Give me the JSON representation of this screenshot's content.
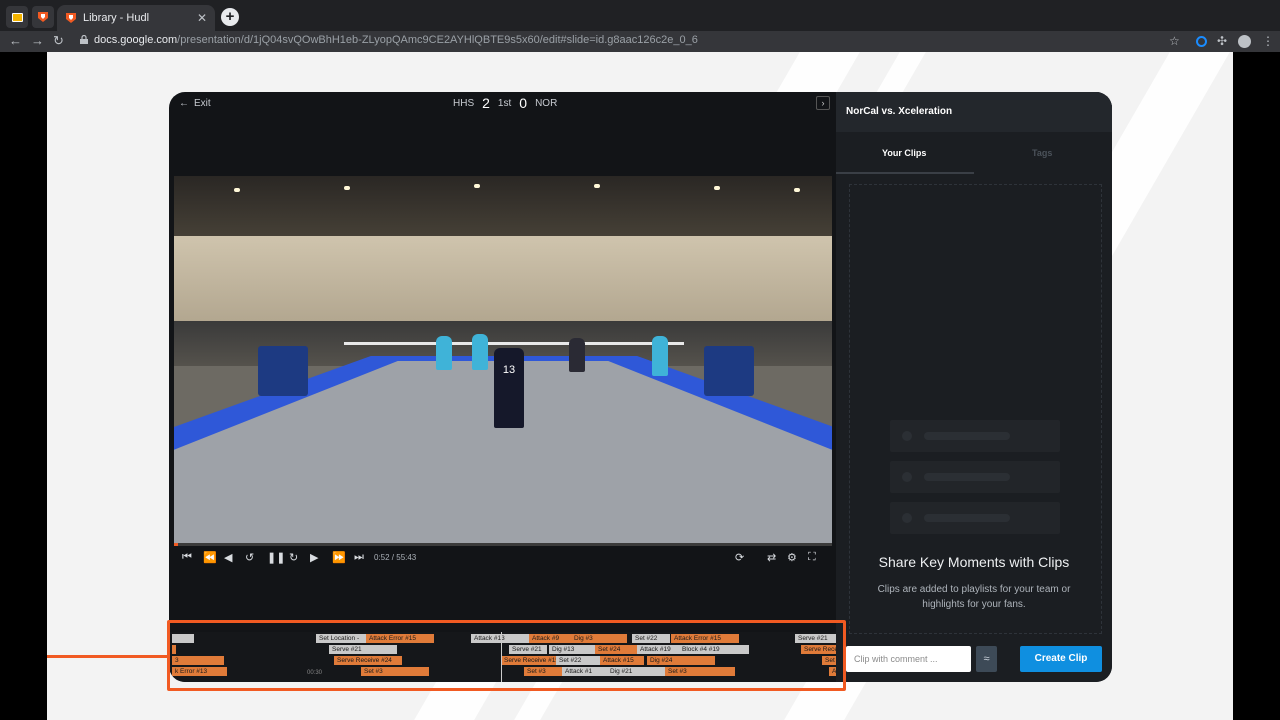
{
  "browser": {
    "tab_title": "Library - Hudl",
    "url_host": "docs.google.com",
    "url_path": "/presentation/d/1jQ04svQOwBhH1eb-ZLyopQAmc9CE2AYHlQBTE9s5x60/edit#slide=id.g8aac126c2e_0_6"
  },
  "player": {
    "exit_label": "Exit",
    "team_home": "HHS",
    "score_home": "2",
    "period": "1st",
    "score_away": "0",
    "team_away": "NOR",
    "timecode": "0:52 / 55:43",
    "jersey": "13"
  },
  "timeline": {
    "time_marker": "00:30",
    "segments": [
      {
        "label": "",
        "c": "g"
      },
      {
        "label": "Set Location -",
        "c": "g"
      },
      {
        "label": "Attack Error #15",
        "c": "o"
      },
      {
        "label": "Attack #13",
        "c": "g"
      },
      {
        "label": "Attack #9",
        "c": "o"
      },
      {
        "label": "Dig #3",
        "c": "o"
      },
      {
        "label": "Set #22",
        "c": "g"
      },
      {
        "label": "Attack Error #15",
        "c": "o"
      },
      {
        "label": "Serve #21",
        "c": "g"
      },
      {
        "label": "",
        "c": "o"
      },
      {
        "label": "Serve #21",
        "c": "g"
      },
      {
        "label": "Serve #21",
        "c": "g"
      },
      {
        "label": "Dig #13",
        "c": "g"
      },
      {
        "label": "Set #24",
        "c": "o"
      },
      {
        "label": "Attack #19",
        "c": "g"
      },
      {
        "label": "Block #4 #19",
        "c": "g"
      },
      {
        "label": "Serve Receiv",
        "c": "o"
      },
      {
        "label": "3",
        "c": "o"
      },
      {
        "label": "Serve Receive #24",
        "c": "o"
      },
      {
        "label": "Serve Receive #15",
        "c": "o"
      },
      {
        "label": "Set #22",
        "c": "g"
      },
      {
        "label": "Attack #15",
        "c": "o"
      },
      {
        "label": "Dig #24",
        "c": "o"
      },
      {
        "label": "Set",
        "c": "o"
      },
      {
        "label": "k Error #13",
        "c": "o"
      },
      {
        "label": "Set #3",
        "c": "o"
      },
      {
        "label": "Set #3",
        "c": "o"
      },
      {
        "label": "Attack #1",
        "c": "g"
      },
      {
        "label": "Dig #21",
        "c": "g"
      },
      {
        "label": "Set #3",
        "c": "o"
      },
      {
        "label": "At",
        "c": "o"
      }
    ]
  },
  "sidebar": {
    "title": "NorCal vs. Xceleration",
    "tab_clips": "Your Clips",
    "tab_tags": "Tags",
    "share_title": "Share Key Moments with Clips",
    "share_text": "Clips are added to playlists for your team or highlights for your fans.",
    "comment_placeholder": "Clip with comment ...",
    "create_button": "Create Clip"
  },
  "colors": {
    "accent_orange": "#f15a22",
    "create_blue": "#0f8fe0",
    "tag_orange": "#e07b39",
    "tag_gray": "#c9c9c9"
  }
}
